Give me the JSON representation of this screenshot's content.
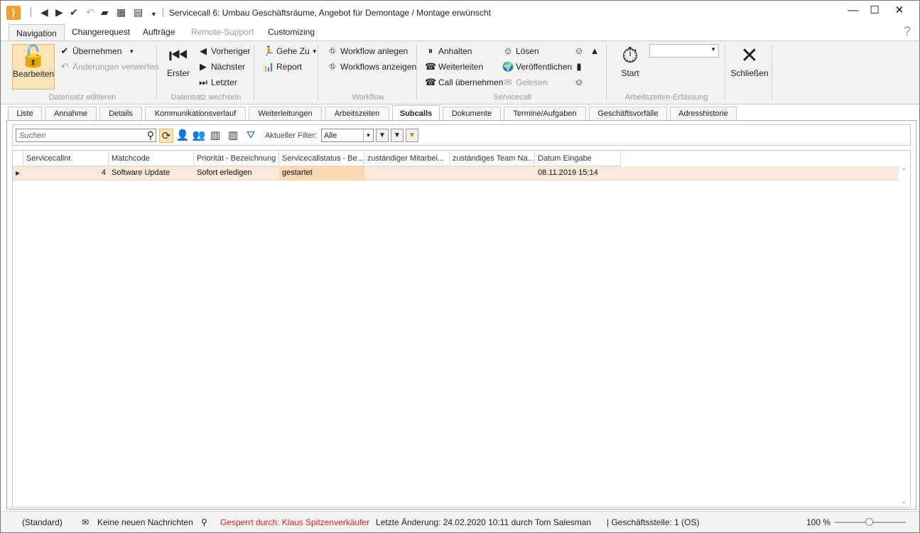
{
  "window": {
    "title": "Servicecall 6: Umbau Geschäftsräume, Angebot für Demontage / Montage erwünscht",
    "minimize": "—",
    "maximize": "☐",
    "close": "✕"
  },
  "ribbon_tabs": [
    {
      "label": "Navigation",
      "active": true
    },
    {
      "label": "Changerequest"
    },
    {
      "label": "Aufträge"
    },
    {
      "label": "Remote-Support",
      "disabled": true
    },
    {
      "label": "Customizing"
    }
  ],
  "help": "?",
  "ribbon": {
    "datensatz_editieren": {
      "label": "Datensatz editieren",
      "bearbeiten": "Bearbeiten",
      "uebernehmen": "Übernehmen",
      "verwerfen": "Änderungen verwerfen"
    },
    "datensatz_wechseln": {
      "label": "Datensatz wechseln",
      "erster": "Erster",
      "vorheriger": "Vorheriger",
      "naechster": "Nächster",
      "letzter": "Letzter"
    },
    "misc": {
      "gehe_zu": "Gehe Zu",
      "report": "Report"
    },
    "workflow": {
      "label": "Workflow",
      "anlegen": "Workflow anlegen",
      "anzeigen": "Workflows anzeigen"
    },
    "servicecall": {
      "label": "Servicecall",
      "anhalten": "Anhalten",
      "weiterleiten": "Weiterleiten",
      "call_uebernehmen": "Call übernehmen",
      "loesen": "Lösen",
      "veroeffentlichen": "Veröffentlichen",
      "gelesen": "Gelesen"
    },
    "arbeitszeiten": {
      "label": "Arbeitszeiten-Erfassung",
      "start": "Start"
    },
    "schliessen": "Schließen"
  },
  "content_tabs": [
    {
      "label": "Liste"
    },
    {
      "label": "Annahme"
    },
    {
      "label": "Details"
    },
    {
      "label": "Kommunikationsverlauf"
    },
    {
      "label": "Weiterleitungen"
    },
    {
      "label": "Arbeitszeiten"
    },
    {
      "label": "Subcalls",
      "active": true
    },
    {
      "label": "Dokumente"
    },
    {
      "label": "Termine/Aufgaben"
    },
    {
      "label": "Geschäftsvorfälle"
    },
    {
      "label": "Adresshistorie"
    }
  ],
  "toolbar": {
    "search_placeholder": "Suchen",
    "filter_label": "Aktueller Filter:",
    "filter_value": "Alle"
  },
  "grid": {
    "columns": [
      "Servicecallnr.",
      "Matchcode",
      "Priorität - Bezeichnung",
      "Servicecallstatus - Be...",
      "zuständiger Mitarbei...",
      "zuständiges Team Na...",
      "Datum Eingabe"
    ],
    "rows": [
      [
        "4",
        "Software Update",
        "Sofort erledigen",
        "gestartet",
        "",
        "",
        "08.11.2019 15:14"
      ]
    ]
  },
  "statusbar": {
    "profile": "(Standard)",
    "messages": "Keine neuen Nachrichten",
    "locked": "Gesperrt durch: Klaus Spitzenverkäufer",
    "last_change": "Letzte Änderung: 24.02.2020 10:11 durch Tom Salesman",
    "branch": "| Geschäftsstelle:  1 (OS)",
    "zoom": "100 %"
  }
}
